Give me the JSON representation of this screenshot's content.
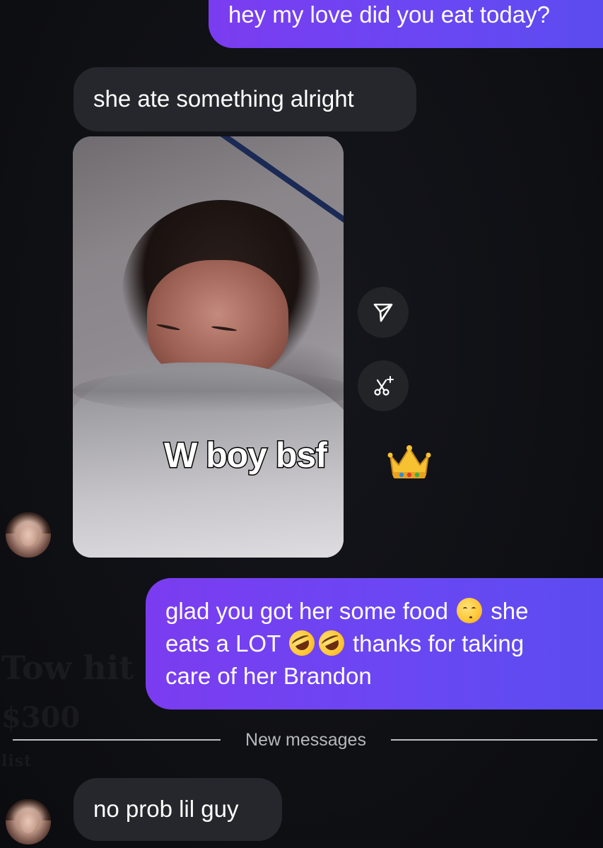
{
  "messages": [
    {
      "direction": "outgoing",
      "text": "hey my love did you eat today?"
    },
    {
      "direction": "incoming",
      "text": "she ate something alright"
    },
    {
      "direction": "incoming",
      "type": "photo",
      "caption": "W boy bsf",
      "caption_emoji": "crown-icon"
    },
    {
      "direction": "outgoing",
      "line1_a": "glad you got her some food",
      "line1_emoji": "pleading-face-icon",
      "line1_b": "she",
      "line2_a": "eats a LOT",
      "line2_emoji": "rolling-laughing-icon",
      "line2_b": "thanks for taking",
      "line3": "care of her Brandon"
    },
    {
      "direction": "incoming",
      "text": "no prob lil guy"
    }
  ],
  "divider": {
    "label": "New messages"
  },
  "actions": [
    {
      "name": "share",
      "icon": "paper-plane-icon"
    },
    {
      "name": "remix",
      "icon": "scissors-sparkle-icon"
    }
  ],
  "background_ghost": {
    "line1": "Tow hit",
    "line2": "$300",
    "line3": "list"
  },
  "colors": {
    "outgoing_bubble": "#6a47f2",
    "incoming_bubble": "#26272c",
    "background": "#0f1014",
    "divider_text": "#b7b8bd"
  }
}
